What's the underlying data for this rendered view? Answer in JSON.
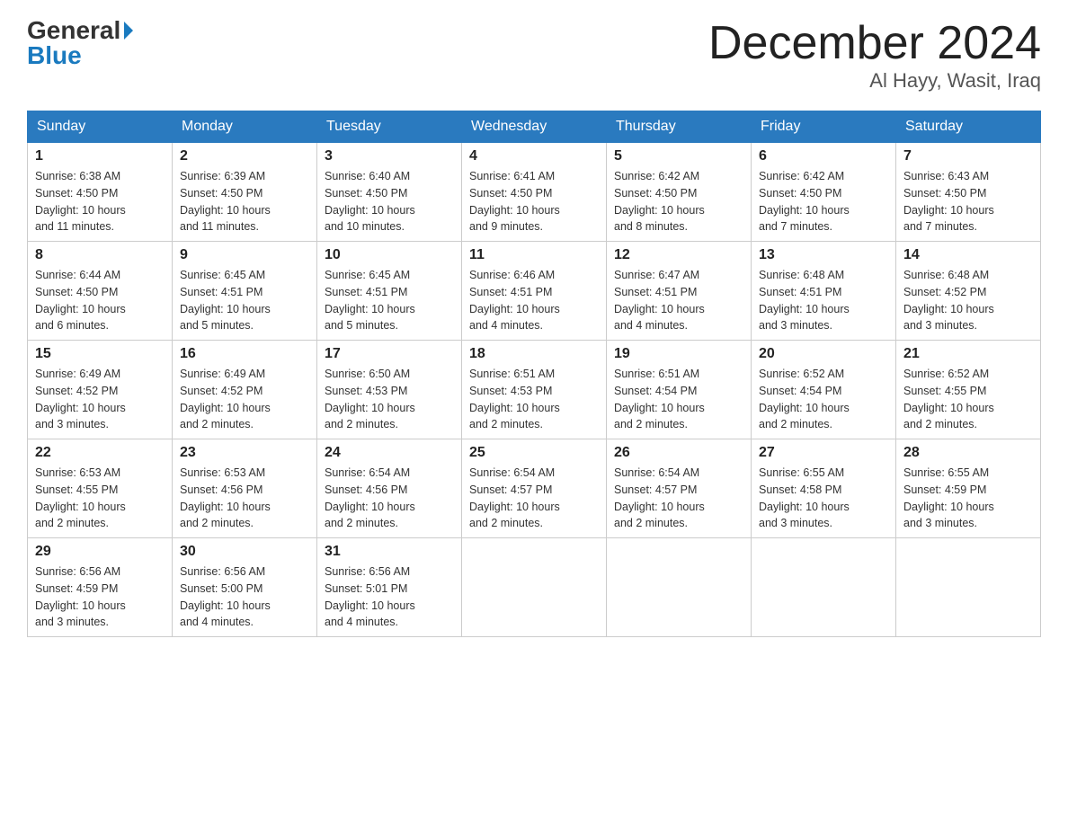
{
  "header": {
    "logo_general": "General",
    "logo_blue": "Blue",
    "month_title": "December 2024",
    "location": "Al Hayy, Wasit, Iraq"
  },
  "days_of_week": [
    "Sunday",
    "Monday",
    "Tuesday",
    "Wednesday",
    "Thursday",
    "Friday",
    "Saturday"
  ],
  "weeks": [
    [
      {
        "day": "1",
        "sunrise": "6:38 AM",
        "sunset": "4:50 PM",
        "daylight": "10 hours and 11 minutes."
      },
      {
        "day": "2",
        "sunrise": "6:39 AM",
        "sunset": "4:50 PM",
        "daylight": "10 hours and 11 minutes."
      },
      {
        "day": "3",
        "sunrise": "6:40 AM",
        "sunset": "4:50 PM",
        "daylight": "10 hours and 10 minutes."
      },
      {
        "day": "4",
        "sunrise": "6:41 AM",
        "sunset": "4:50 PM",
        "daylight": "10 hours and 9 minutes."
      },
      {
        "day": "5",
        "sunrise": "6:42 AM",
        "sunset": "4:50 PM",
        "daylight": "10 hours and 8 minutes."
      },
      {
        "day": "6",
        "sunrise": "6:42 AM",
        "sunset": "4:50 PM",
        "daylight": "10 hours and 7 minutes."
      },
      {
        "day": "7",
        "sunrise": "6:43 AM",
        "sunset": "4:50 PM",
        "daylight": "10 hours and 7 minutes."
      }
    ],
    [
      {
        "day": "8",
        "sunrise": "6:44 AM",
        "sunset": "4:50 PM",
        "daylight": "10 hours and 6 minutes."
      },
      {
        "day": "9",
        "sunrise": "6:45 AM",
        "sunset": "4:51 PM",
        "daylight": "10 hours and 5 minutes."
      },
      {
        "day": "10",
        "sunrise": "6:45 AM",
        "sunset": "4:51 PM",
        "daylight": "10 hours and 5 minutes."
      },
      {
        "day": "11",
        "sunrise": "6:46 AM",
        "sunset": "4:51 PM",
        "daylight": "10 hours and 4 minutes."
      },
      {
        "day": "12",
        "sunrise": "6:47 AM",
        "sunset": "4:51 PM",
        "daylight": "10 hours and 4 minutes."
      },
      {
        "day": "13",
        "sunrise": "6:48 AM",
        "sunset": "4:51 PM",
        "daylight": "10 hours and 3 minutes."
      },
      {
        "day": "14",
        "sunrise": "6:48 AM",
        "sunset": "4:52 PM",
        "daylight": "10 hours and 3 minutes."
      }
    ],
    [
      {
        "day": "15",
        "sunrise": "6:49 AM",
        "sunset": "4:52 PM",
        "daylight": "10 hours and 3 minutes."
      },
      {
        "day": "16",
        "sunrise": "6:49 AM",
        "sunset": "4:52 PM",
        "daylight": "10 hours and 2 minutes."
      },
      {
        "day": "17",
        "sunrise": "6:50 AM",
        "sunset": "4:53 PM",
        "daylight": "10 hours and 2 minutes."
      },
      {
        "day": "18",
        "sunrise": "6:51 AM",
        "sunset": "4:53 PM",
        "daylight": "10 hours and 2 minutes."
      },
      {
        "day": "19",
        "sunrise": "6:51 AM",
        "sunset": "4:54 PM",
        "daylight": "10 hours and 2 minutes."
      },
      {
        "day": "20",
        "sunrise": "6:52 AM",
        "sunset": "4:54 PM",
        "daylight": "10 hours and 2 minutes."
      },
      {
        "day": "21",
        "sunrise": "6:52 AM",
        "sunset": "4:55 PM",
        "daylight": "10 hours and 2 minutes."
      }
    ],
    [
      {
        "day": "22",
        "sunrise": "6:53 AM",
        "sunset": "4:55 PM",
        "daylight": "10 hours and 2 minutes."
      },
      {
        "day": "23",
        "sunrise": "6:53 AM",
        "sunset": "4:56 PM",
        "daylight": "10 hours and 2 minutes."
      },
      {
        "day": "24",
        "sunrise": "6:54 AM",
        "sunset": "4:56 PM",
        "daylight": "10 hours and 2 minutes."
      },
      {
        "day": "25",
        "sunrise": "6:54 AM",
        "sunset": "4:57 PM",
        "daylight": "10 hours and 2 minutes."
      },
      {
        "day": "26",
        "sunrise": "6:54 AM",
        "sunset": "4:57 PM",
        "daylight": "10 hours and 2 minutes."
      },
      {
        "day": "27",
        "sunrise": "6:55 AM",
        "sunset": "4:58 PM",
        "daylight": "10 hours and 3 minutes."
      },
      {
        "day": "28",
        "sunrise": "6:55 AM",
        "sunset": "4:59 PM",
        "daylight": "10 hours and 3 minutes."
      }
    ],
    [
      {
        "day": "29",
        "sunrise": "6:56 AM",
        "sunset": "4:59 PM",
        "daylight": "10 hours and 3 minutes."
      },
      {
        "day": "30",
        "sunrise": "6:56 AM",
        "sunset": "5:00 PM",
        "daylight": "10 hours and 4 minutes."
      },
      {
        "day": "31",
        "sunrise": "6:56 AM",
        "sunset": "5:01 PM",
        "daylight": "10 hours and 4 minutes."
      },
      null,
      null,
      null,
      null
    ]
  ],
  "labels": {
    "sunrise": "Sunrise:",
    "sunset": "Sunset:",
    "daylight": "Daylight:"
  }
}
